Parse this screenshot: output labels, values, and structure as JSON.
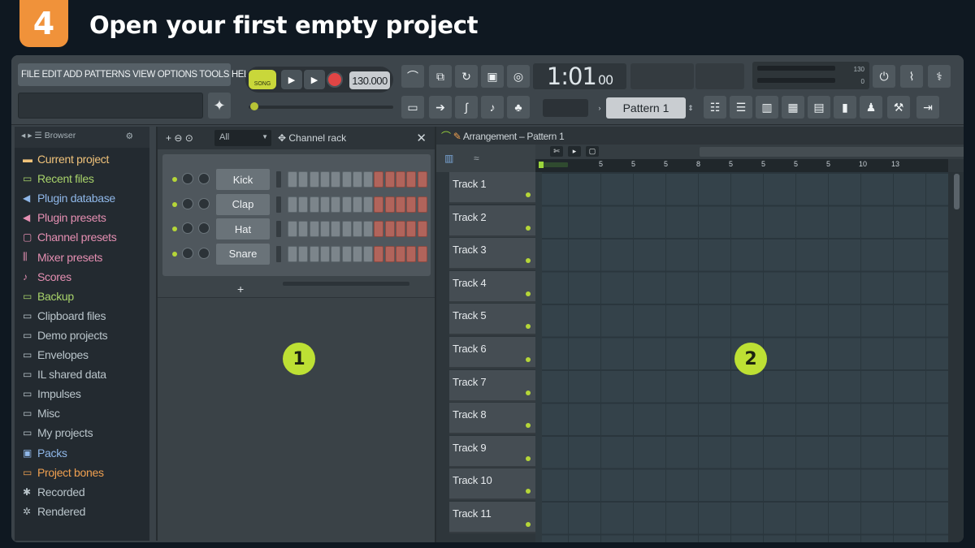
{
  "header": {
    "step_number": "4",
    "title": "Open your first empty project"
  },
  "menu": {
    "text": "FILE EDIT ADD PATTERNS VIEW OPTIONS TOOLS HELP"
  },
  "transport": {
    "mode": "SONG",
    "tempo": "130.000"
  },
  "time": {
    "main": "1:01",
    "sub": "00"
  },
  "cpu": {
    "value1": "130",
    "value2": "0"
  },
  "pattern": {
    "selected": "Pattern 1"
  },
  "browser": {
    "title": "Browser",
    "items": [
      {
        "label": "Current project",
        "icon": "file-icon",
        "color": "#f0c27a"
      },
      {
        "label": "Recent files",
        "icon": "folder-icon",
        "color": "#a8d36a"
      },
      {
        "label": "Plugin database",
        "icon": "plugin-icon",
        "color": "#8fb7e8"
      },
      {
        "label": "Plugin presets",
        "icon": "plugin-icon",
        "color": "#e58fb2"
      },
      {
        "label": "Channel presets",
        "icon": "channel-icon",
        "color": "#e58fb2"
      },
      {
        "label": "Mixer presets",
        "icon": "mixer-icon",
        "color": "#e58fb2"
      },
      {
        "label": "Scores",
        "icon": "note-icon",
        "color": "#e58fb2"
      },
      {
        "label": "Backup",
        "icon": "folder-icon",
        "color": "#a8d36a"
      },
      {
        "label": "Clipboard files",
        "icon": "folder-icon",
        "color": "#b9c4ca"
      },
      {
        "label": "Demo projects",
        "icon": "folder-icon",
        "color": "#b9c4ca"
      },
      {
        "label": "Envelopes",
        "icon": "folder-icon",
        "color": "#b9c4ca"
      },
      {
        "label": "IL shared data",
        "icon": "folder-icon",
        "color": "#b9c4ca"
      },
      {
        "label": "Impulses",
        "icon": "folder-icon",
        "color": "#b9c4ca"
      },
      {
        "label": "Misc",
        "icon": "folder-icon",
        "color": "#b9c4ca"
      },
      {
        "label": "My projects",
        "icon": "folder-icon",
        "color": "#b9c4ca"
      },
      {
        "label": "Packs",
        "icon": "pack-icon",
        "color": "#8fb7e8"
      },
      {
        "label": "Project bones",
        "icon": "folder-icon",
        "color": "#f0a050"
      },
      {
        "label": "Recorded",
        "icon": "recorded-icon",
        "color": "#b9c4ca"
      },
      {
        "label": "Rendered",
        "icon": "rendered-icon",
        "color": "#b9c4ca"
      }
    ]
  },
  "channel_rack": {
    "title": "Channel rack",
    "filter": "All",
    "channels": [
      {
        "name": "Kick",
        "steps": [
          "off",
          "off",
          "off",
          "off",
          "off",
          "off",
          "off",
          "off",
          "on",
          "on",
          "on",
          "on",
          "on"
        ]
      },
      {
        "name": "Clap",
        "steps": [
          "off",
          "off",
          "off",
          "off",
          "off",
          "off",
          "off",
          "off",
          "on",
          "on",
          "on",
          "on",
          "on"
        ]
      },
      {
        "name": "Hat",
        "steps": [
          "off",
          "off",
          "off",
          "off",
          "off",
          "off",
          "off",
          "off",
          "on",
          "on",
          "on",
          "on",
          "on"
        ]
      },
      {
        "name": "Snare",
        "steps": [
          "off",
          "off",
          "off",
          "off",
          "off",
          "off",
          "off",
          "off",
          "on",
          "on",
          "on",
          "on",
          "on"
        ]
      }
    ],
    "add_label": "+"
  },
  "arrangement": {
    "title": "Arrangement – Pattern 1",
    "ruler": [
      "5",
      "5",
      "5",
      "8",
      "5",
      "5",
      "5",
      "5",
      "10",
      "13"
    ],
    "tracks": [
      "Track 1",
      "Track 2",
      "Track 3",
      "Track 4",
      "Track 5",
      "Track 6",
      "Track 7",
      "Track 8",
      "Track 9",
      "Track 10",
      "Track 11"
    ]
  },
  "markers": [
    "1",
    "2"
  ],
  "colors": {
    "accent_orange": "#f0923a",
    "accent_lime": "#bde034",
    "step_active": "#b1645b"
  }
}
